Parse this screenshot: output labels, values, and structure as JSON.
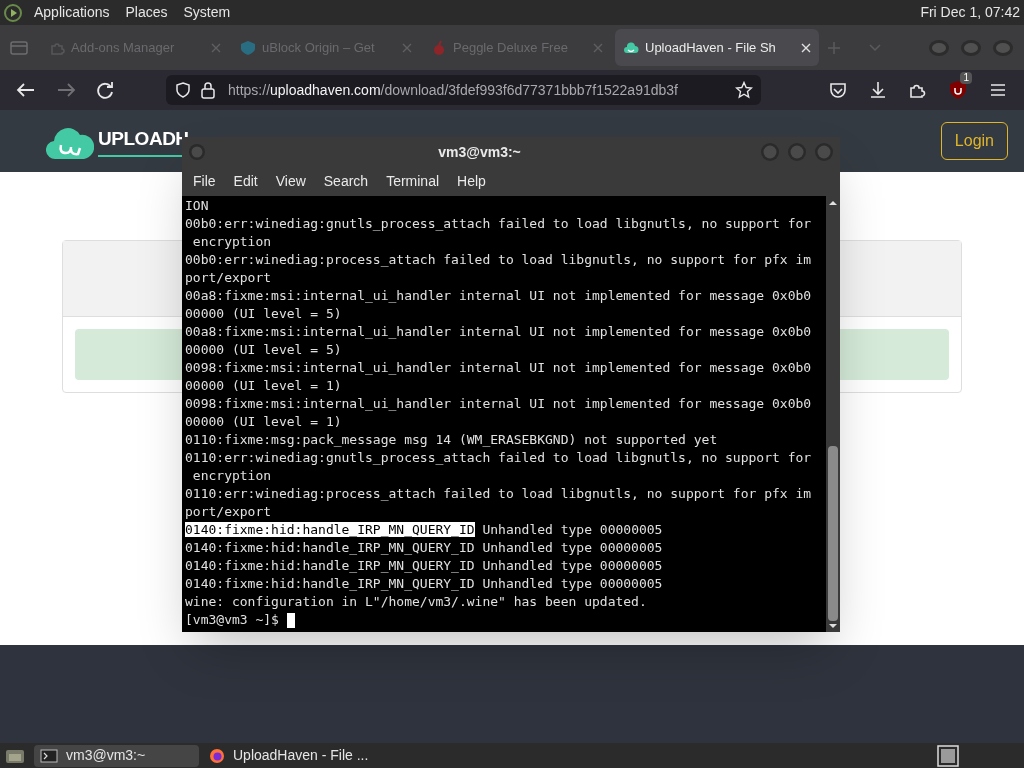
{
  "top_panel": {
    "menus": [
      "Applications",
      "Places",
      "System"
    ],
    "clock": "Fri Dec 1, 07:42"
  },
  "browser": {
    "tabs": [
      {
        "label": "Add-ons Manager",
        "selected": false,
        "kind": "puzzle"
      },
      {
        "label": "uBlock Origin – Get",
        "selected": false,
        "kind": "ublock"
      },
      {
        "label": "Peggle Deluxe Free",
        "selected": false,
        "kind": "peggle"
      },
      {
        "label": "UploadHaven - File Sh",
        "selected": true,
        "kind": "cloud"
      }
    ],
    "url_prefix": "https://",
    "url_host": "uploadhaven.com",
    "url_path": "/download/3fdef993f6d77371bbb7f1522a91db3f",
    "extension_badge": "1"
  },
  "site": {
    "logo_text": "UPLOADH",
    "login": "Login"
  },
  "terminal": {
    "title": "vm3@vm3:~",
    "menu": [
      "File",
      "Edit",
      "View",
      "Search",
      "Terminal",
      "Help"
    ],
    "lines": [
      {
        "text": "ION"
      },
      {
        "text": "00b0:err:winediag:gnutls_process_attach failed to load libgnutls, no support for"
      },
      {
        "text": " encryption"
      },
      {
        "text": "00b0:err:winediag:process_attach failed to load libgnutls, no support for pfx im"
      },
      {
        "text": "port/export"
      },
      {
        "text": "00a8:fixme:msi:internal_ui_handler internal UI not implemented for message 0x0b0"
      },
      {
        "text": "00000 (UI level = 5)"
      },
      {
        "text": "00a8:fixme:msi:internal_ui_handler internal UI not implemented for message 0x0b0"
      },
      {
        "text": "00000 (UI level = 5)"
      },
      {
        "text": "0098:fixme:msi:internal_ui_handler internal UI not implemented for message 0x0b0"
      },
      {
        "text": "00000 (UI level = 1)"
      },
      {
        "text": "0098:fixme:msi:internal_ui_handler internal UI not implemented for message 0x0b0"
      },
      {
        "text": "00000 (UI level = 1)"
      },
      {
        "text": "0110:fixme:msg:pack_message msg 14 (WM_ERASEBKGND) not supported yet"
      },
      {
        "text": "0110:err:winediag:gnutls_process_attach failed to load libgnutls, no support for"
      },
      {
        "text": " encryption"
      },
      {
        "text": "0110:err:winediag:process_attach failed to load libgnutls, no support for pfx im"
      },
      {
        "text": "port/export"
      },
      {
        "highlighted": "0140:fixme:hid:handle_IRP_MN_QUERY_ID",
        "text": " Unhandled type 00000005"
      },
      {
        "text": "0140:fixme:hid:handle_IRP_MN_QUERY_ID Unhandled type 00000005"
      },
      {
        "text": "0140:fixme:hid:handle_IRP_MN_QUERY_ID Unhandled type 00000005"
      },
      {
        "text": "0140:fixme:hid:handle_IRP_MN_QUERY_ID Unhandled type 00000005"
      },
      {
        "text": "wine: configuration in L\"/home/vm3/.wine\" has been updated."
      }
    ],
    "prompt": "[vm3@vm3 ~]$ "
  },
  "taskbar": {
    "tasks": [
      {
        "label": "vm3@vm3:~",
        "selected": true,
        "kind": "terminal"
      },
      {
        "label": "UploadHaven - File ...",
        "selected": false,
        "kind": "firefox"
      }
    ]
  }
}
